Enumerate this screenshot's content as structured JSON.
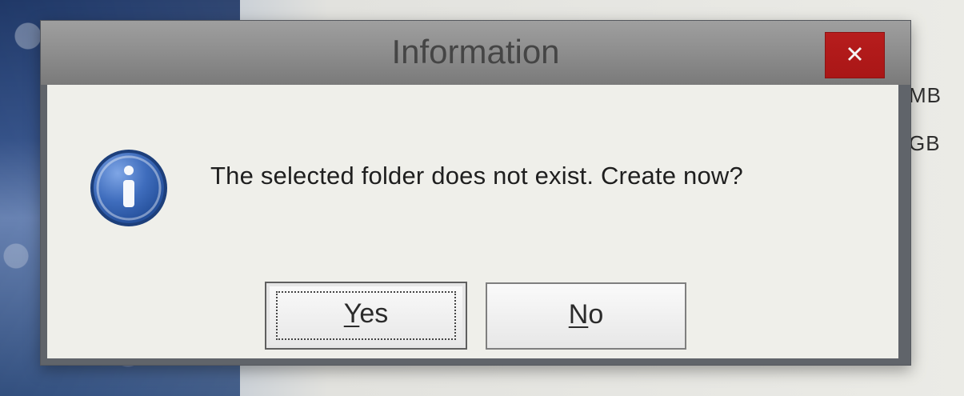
{
  "dialog": {
    "title": "Information",
    "message": "The selected folder does not exist. Create now?",
    "buttons": {
      "yes_mnemonic": "Y",
      "yes_rest": "es",
      "no_mnemonic": "N",
      "no_rest": "o"
    },
    "icons": {
      "close": "close-icon",
      "info": "info-icon"
    }
  },
  "background": {
    "right_texts": {
      "mb": "MB",
      "gb": "GB"
    }
  },
  "colors": {
    "titlebar": "#8e8e8e",
    "close_button": "#b71d1d",
    "content": "#efefea",
    "info_blue": "#2d5ca8"
  }
}
